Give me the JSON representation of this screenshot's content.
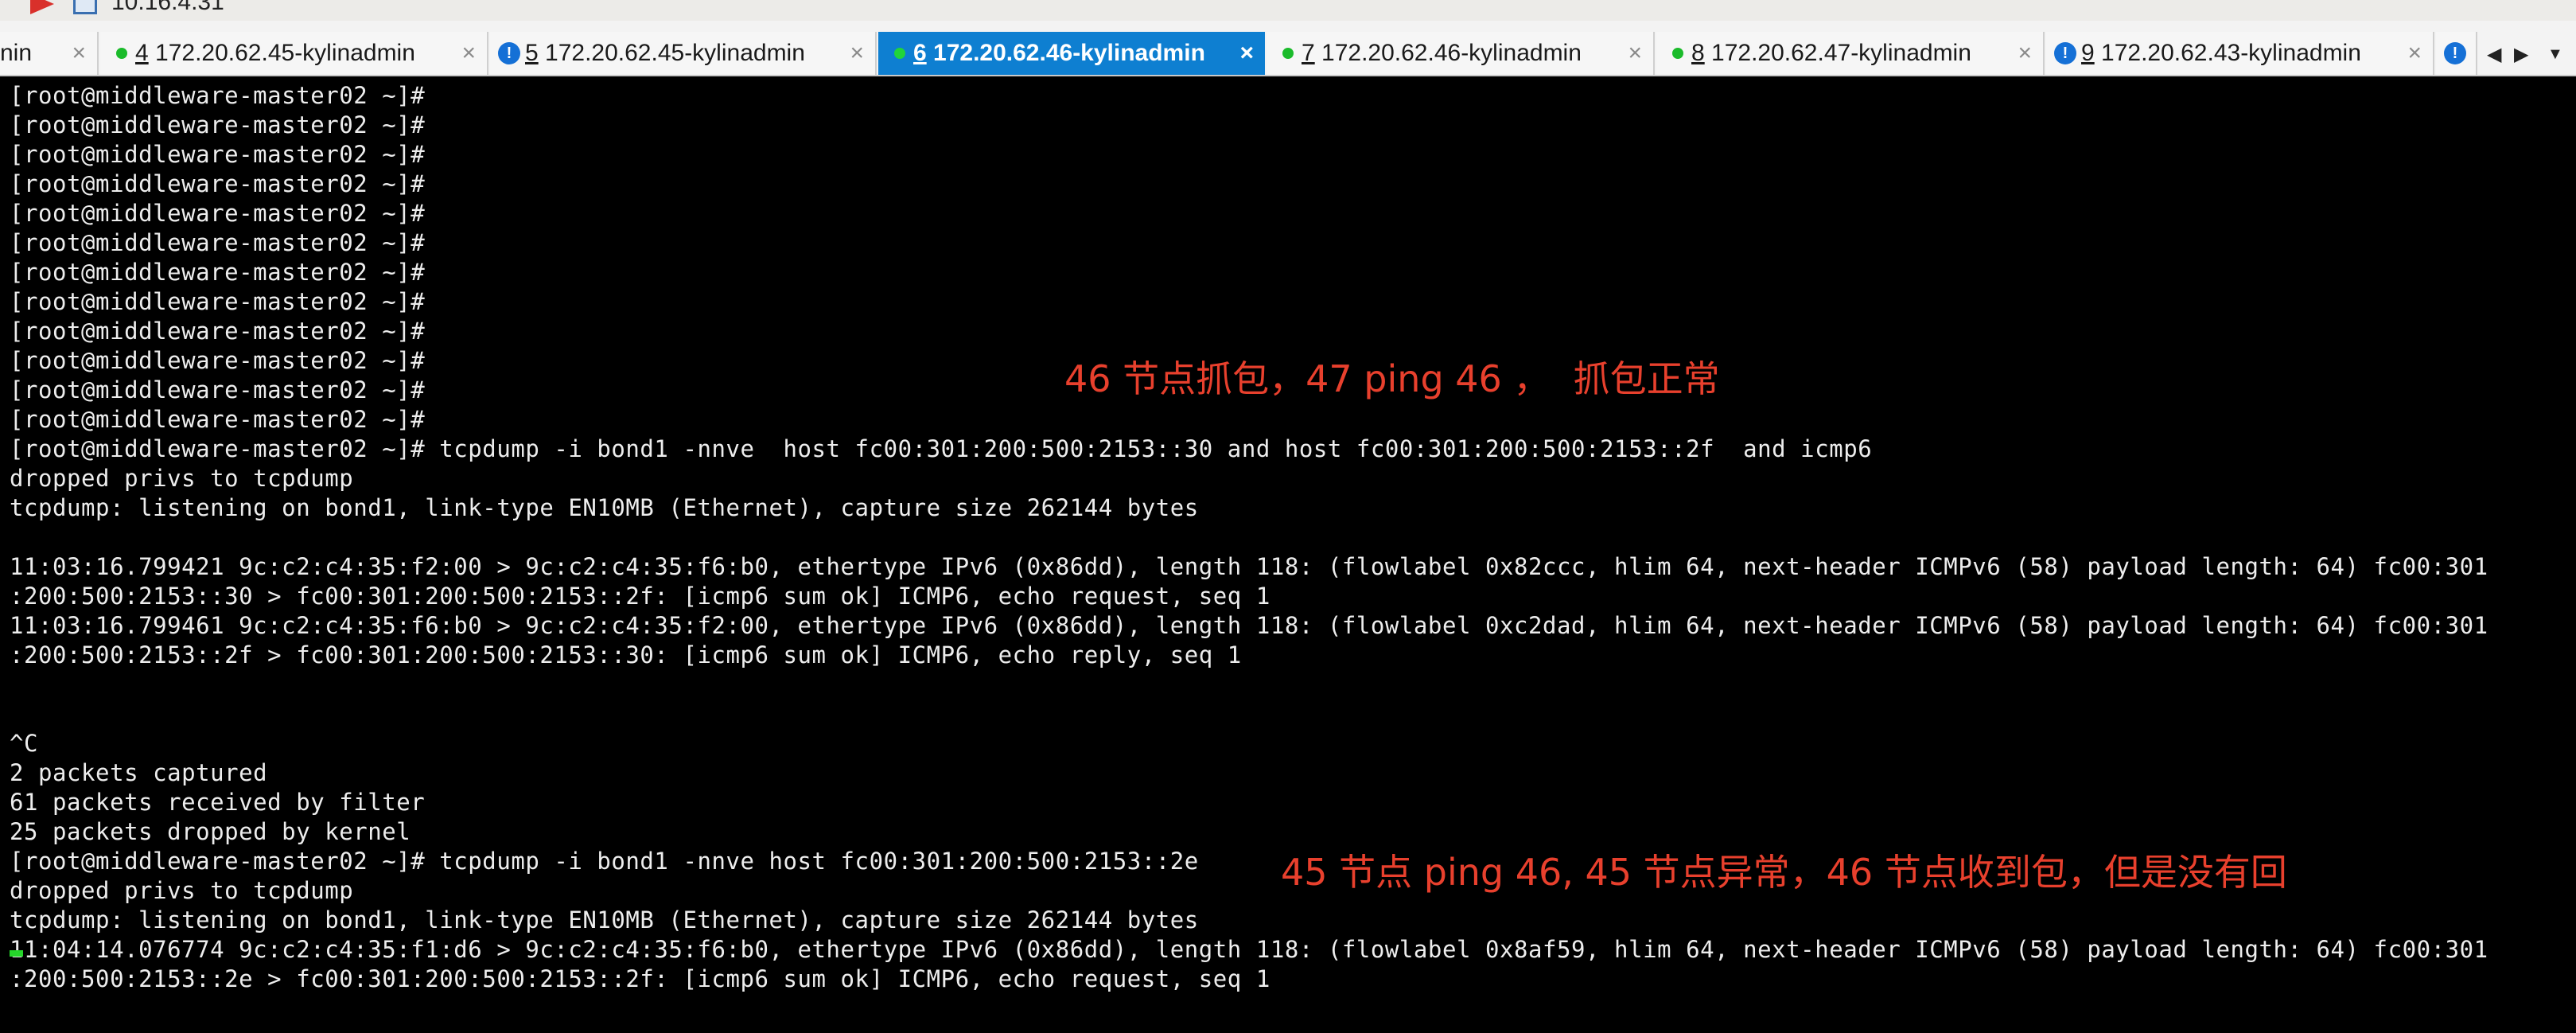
{
  "window": {
    "title": "10.16.4.31",
    "flag_icon": "flag-icon",
    "app_icon": "app-icon"
  },
  "tabs": [
    {
      "num": "",
      "label": "nin",
      "status": "none"
    },
    {
      "num": "4",
      "label": " 172.20.62.45-kylinadmin",
      "status": "green"
    },
    {
      "num": "5",
      "label": " 172.20.62.45-kylinadmin",
      "status": "info"
    },
    {
      "num": "6",
      "label": " 172.20.62.46-kylinadmin",
      "status": "active"
    },
    {
      "num": "7",
      "label": " 172.20.62.46-kylinadmin",
      "status": "green"
    },
    {
      "num": "8",
      "label": " 172.20.62.47-kylinadmin",
      "status": "green"
    },
    {
      "num": "9",
      "label": " 172.20.62.43-kylinadmin",
      "status": "info"
    }
  ],
  "tab_close_glyph": "×",
  "tab_controls": {
    "prev": "◀",
    "next": "▶",
    "menu": "▼",
    "overflow_icon": "!"
  },
  "terminal": {
    "lines": [
      "[root@middleware-master02 ~]#",
      "[root@middleware-master02 ~]#",
      "[root@middleware-master02 ~]#",
      "[root@middleware-master02 ~]#",
      "[root@middleware-master02 ~]#",
      "[root@middleware-master02 ~]#",
      "[root@middleware-master02 ~]#",
      "[root@middleware-master02 ~]#",
      "[root@middleware-master02 ~]#",
      "[root@middleware-master02 ~]#",
      "[root@middleware-master02 ~]#",
      "[root@middleware-master02 ~]#",
      "[root@middleware-master02 ~]# tcpdump -i bond1 -nnve  host fc00:301:200:500:2153::30 and host fc00:301:200:500:2153::2f  and icmp6",
      "dropped privs to tcpdump",
      "tcpdump: listening on bond1, link-type EN10MB (Ethernet), capture size 262144 bytes",
      "",
      "11:03:16.799421 9c:c2:c4:35:f2:00 > 9c:c2:c4:35:f6:b0, ethertype IPv6 (0x86dd), length 118: (flowlabel 0x82ccc, hlim 64, next-header ICMPv6 (58) payload length: 64) fc00:301",
      ":200:500:2153::30 > fc00:301:200:500:2153::2f: [icmp6 sum ok] ICMP6, echo request, seq 1",
      "11:03:16.799461 9c:c2:c4:35:f6:b0 > 9c:c2:c4:35:f2:00, ethertype IPv6 (0x86dd), length 118: (flowlabel 0xc2dad, hlim 64, next-header ICMPv6 (58) payload length: 64) fc00:301",
      ":200:500:2153::2f > fc00:301:200:500:2153::30: [icmp6 sum ok] ICMP6, echo reply, seq 1",
      "",
      "",
      "^C",
      "2 packets captured",
      "61 packets received by filter",
      "25 packets dropped by kernel",
      "[root@middleware-master02 ~]# tcpdump -i bond1 -nnve host fc00:301:200:500:2153::2e",
      "dropped privs to tcpdump",
      "tcpdump: listening on bond1, link-type EN10MB (Ethernet), capture size 262144 bytes",
      "11:04:14.076774 9c:c2:c4:35:f1:d6 > 9c:c2:c4:35:f6:b0, ethertype IPv6 (0x86dd), length 118: (flowlabel 0x8af59, hlim 64, next-header ICMPv6 (58) payload length: 64) fc00:301",
      ":200:500:2153::2e > fc00:301:200:500:2153::2f: [icmp6 sum ok] ICMP6, echo request, seq 1"
    ]
  },
  "annotations": {
    "first": "46 节点抓包，47 ping 46 ，  抓包正常",
    "second": "45 节点 ping 46, 45 节点异常，46 节点收到包，但是没有回"
  },
  "colors": {
    "active_tab": "#0e7fd1",
    "annotation": "#e8402d",
    "cursor": "#25d52a",
    "green_dot": "#1bbb2b",
    "info_icon": "#1570d6"
  }
}
